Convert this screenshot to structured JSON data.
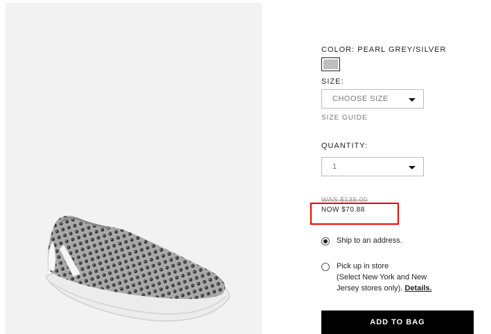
{
  "product": {
    "image_alt": "Pearl grey embellished slip-on sneaker",
    "color_label": "COLOR: PEARL GREY/SILVER",
    "size_label": "SIZE:",
    "size_select": "CHOOSE SIZE",
    "size_guide": "SIZE GUIDE",
    "quantity_label": "QUANTITY:",
    "quantity_select": "1",
    "price_was": "WAS $135.00",
    "price_now": "NOW $70.88"
  },
  "shipping": {
    "option1": "Ship to an address.",
    "option2_line1": "Pick up in store",
    "option2_line2": "(Select New York and New",
    "option2_line3": "Jersey stores only).",
    "details": "Details."
  },
  "actions": {
    "add_to_bag": "ADD TO BAG"
  },
  "colors": {
    "highlight": "#e00000",
    "button": "#000000"
  }
}
